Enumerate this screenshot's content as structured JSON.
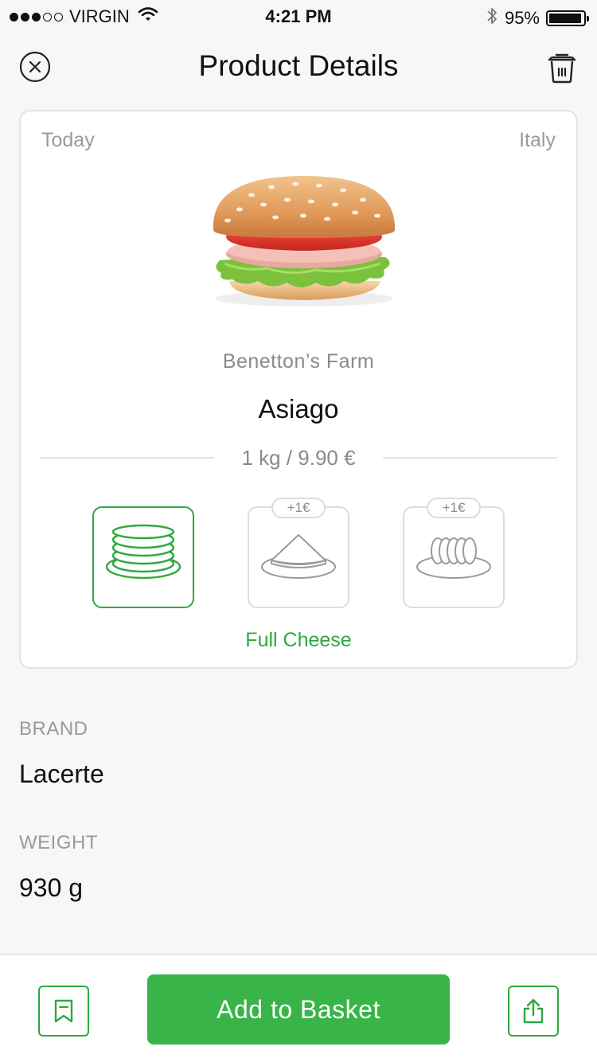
{
  "status_bar": {
    "signal_filled": 3,
    "signal_total": 5,
    "carrier": "VIRGIN",
    "time": "4:21 PM",
    "battery_text": "95%",
    "battery_level": 0.95,
    "icons": [
      "wifi-icon",
      "bluetooth-icon",
      "battery-icon"
    ]
  },
  "nav": {
    "title": "Product Details",
    "left_icon": "close-icon",
    "right_icon": "trash-icon"
  },
  "card": {
    "date": "Today",
    "origin": "Italy",
    "image": "burger-image",
    "farm": "Benetton’s Farm",
    "name": "Asiago",
    "price": "1 kg / 9.90 €",
    "options": [
      {
        "icon": "stacked-slices-icon",
        "selected": true,
        "badge": ""
      },
      {
        "icon": "cheese-wedge-icon",
        "selected": false,
        "badge": "+1€"
      },
      {
        "icon": "sliced-rounds-icon",
        "selected": false,
        "badge": "+1€"
      }
    ],
    "selected_option_label": "Full Cheese"
  },
  "specs": {
    "brand_label": "BRAND",
    "brand_value": "Lacerte",
    "weight_label": "WEIGHT",
    "weight_value": "930 g"
  },
  "bottom_bar": {
    "bookmark_icon": "bookmark-icon",
    "basket_label": "Add to Basket",
    "share_icon": "share-icon"
  },
  "colors": {
    "accent": "#38b449",
    "accent_text": "#2fa83f",
    "muted_text": "#9a9a9a",
    "background": "#f7f7f7"
  }
}
